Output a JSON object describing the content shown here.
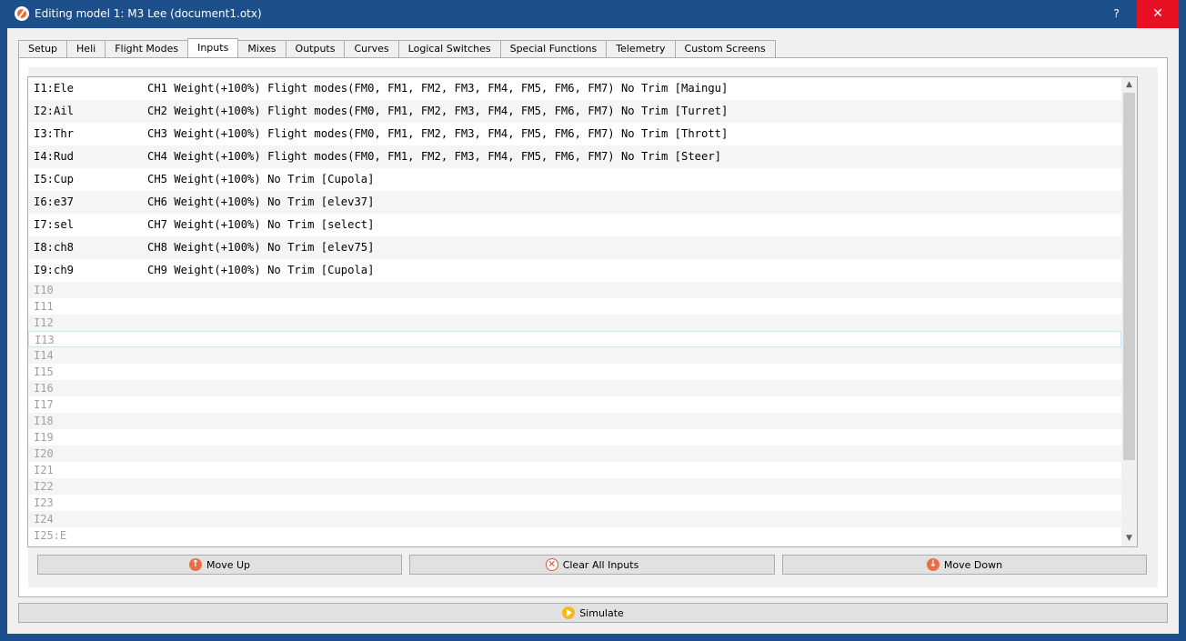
{
  "window": {
    "title": "Editing model 1: M3 Lee   (document1.otx)",
    "help_label": "?",
    "close_label": "✕"
  },
  "tabs": [
    {
      "label": "Setup"
    },
    {
      "label": "Heli"
    },
    {
      "label": "Flight Modes"
    },
    {
      "label": "Inputs",
      "active": true
    },
    {
      "label": "Mixes"
    },
    {
      "label": "Outputs"
    },
    {
      "label": "Curves"
    },
    {
      "label": "Logical Switches"
    },
    {
      "label": "Special Functions"
    },
    {
      "label": "Telemetry"
    },
    {
      "label": "Custom Screens"
    }
  ],
  "inputs": [
    {
      "name": "I1:Ele",
      "desc": "CH1 Weight(+100%) Flight modes(FM0, FM1, FM2, FM3, FM4, FM5, FM6, FM7) No Trim [Maingu]"
    },
    {
      "name": "I2:Ail",
      "desc": "CH2 Weight(+100%) Flight modes(FM0, FM1, FM2, FM3, FM4, FM5, FM6, FM7) No Trim [Turret]"
    },
    {
      "name": "I3:Thr",
      "desc": "CH3 Weight(+100%) Flight modes(FM0, FM1, FM2, FM3, FM4, FM5, FM6, FM7) No Trim [Thrott]"
    },
    {
      "name": "I4:Rud",
      "desc": "CH4 Weight(+100%) Flight modes(FM0, FM1, FM2, FM3, FM4, FM5, FM6, FM7) No Trim [Steer]"
    },
    {
      "name": "I5:Cup",
      "desc": "CH5 Weight(+100%) No Trim [Cupola]"
    },
    {
      "name": "I6:e37",
      "desc": "CH6 Weight(+100%) No Trim [elev37]"
    },
    {
      "name": "I7:sel",
      "desc": "CH7 Weight(+100%) No Trim [select]"
    },
    {
      "name": "I8:ch8",
      "desc": "CH8 Weight(+100%) No Trim [elev75]"
    },
    {
      "name": "I9:ch9",
      "desc": "CH9 Weight(+100%) No Trim [Cupola]"
    }
  ],
  "empty_inputs": [
    "I10",
    "I11",
    "I12",
    "I13",
    "I14",
    "I15",
    "I16",
    "I17",
    "I18",
    "I19",
    "I20",
    "I21",
    "I22",
    "I23",
    "I24",
    "I25:E"
  ],
  "buttons": {
    "move_up": "Move Up",
    "clear_all": "Clear All Inputs",
    "move_down": "Move Down",
    "simulate": "Simulate"
  },
  "icons": {
    "move_up": "arrow-up-icon",
    "clear_all": "clear-icon",
    "move_down": "arrow-down-icon",
    "simulate": "play-icon"
  },
  "colors": {
    "titlebar": "#1d4f8a",
    "close": "#e81123",
    "empty_text": "#a0a0a0",
    "icon_accent": "#e96f4a",
    "play_accent": "#f6b81a"
  }
}
